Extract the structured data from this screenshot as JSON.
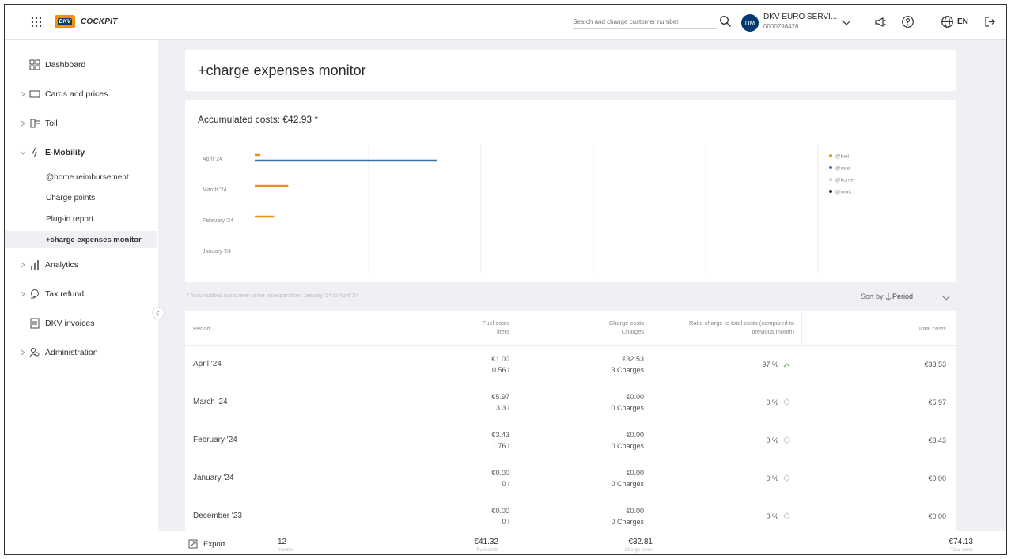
{
  "header": {
    "app_name": "COCKPIT",
    "logo_text": "DKV",
    "search_placeholder": "Search and change customer number",
    "avatar_initials": "DM",
    "customer_name": "DKV EURO SERVI...",
    "customer_number": "0000798428",
    "language": "EN",
    "icons": [
      "apps-grid-icon",
      "search-icon",
      "chevron-down-icon",
      "megaphone-icon",
      "help-icon",
      "globe-icon",
      "logout-icon"
    ]
  },
  "sidebar": {
    "items": [
      {
        "label": "Dashboard",
        "icon": "dashboard-icon"
      },
      {
        "label": "Cards and prices",
        "icon": "card-icon"
      },
      {
        "label": "Toll",
        "icon": "toll-icon"
      },
      {
        "label": "E-Mobility",
        "icon": "lightning-icon"
      },
      {
        "label": "Analytics",
        "icon": "bar-chart-icon"
      },
      {
        "label": "Tax refund",
        "icon": "tax-refund-icon"
      },
      {
        "label": "DKV invoices",
        "icon": "invoice-icon"
      },
      {
        "label": "Administration",
        "icon": "users-icon"
      }
    ],
    "emobility_sub": [
      {
        "label": "@home reimbursement"
      },
      {
        "label": "Charge points"
      },
      {
        "label": "Plug-in report"
      },
      {
        "label": "+charge expenses monitor"
      }
    ]
  },
  "page": {
    "title": "+charge expenses monitor",
    "accumulated": "Accumulated costs: €42.93 *",
    "footnote": "* Accumulated costs refer to the timespan from January '24 to April '24",
    "sort_label": "Sort by:",
    "sort_value": "Period"
  },
  "colors": {
    "fuel": "#e8921e",
    "road": "#3f6fa6",
    "home": "#cccccc",
    "work": "#2b2b2b",
    "brand": "#003a70",
    "accent": "#f39200"
  },
  "chart_data": {
    "type": "bar",
    "orientation": "horizontal",
    "categories": [
      "April '24",
      "March '24",
      "February '24",
      "January '24"
    ],
    "series": [
      {
        "name": "@fuel",
        "values": [
          1.0,
          5.97,
          3.43,
          0.0
        ]
      },
      {
        "name": "@road",
        "values": [
          32.53,
          0,
          0,
          0
        ]
      },
      {
        "name": "@home",
        "values": [
          0,
          0,
          0,
          0
        ]
      },
      {
        "name": "@work",
        "values": [
          0,
          0,
          0,
          0
        ]
      }
    ],
    "xlim": [
      0,
      100
    ],
    "grid": true,
    "legend_position": "right"
  },
  "table": {
    "headers": {
      "period": "Period",
      "fuel": "Fuel costs",
      "fuel_sub": "liters",
      "charge": "Charge costs",
      "charge_sub": "Charges",
      "ratio": "Ratio charge to total costs (compared to",
      "ratio_sub": "previous month)",
      "total": "Total costs"
    },
    "rows": [
      {
        "period": "April '24",
        "fuel": "€1.00",
        "liters": "0.56 l",
        "charge": "€32.53",
        "charges": "3 Charges",
        "ratio": "97 %",
        "trend": "up",
        "total": "€33.53"
      },
      {
        "period": "March '24",
        "fuel": "€5.97",
        "liters": "3.3 l",
        "charge": "€0.00",
        "charges": "0 Charges",
        "ratio": "0 %",
        "trend": "neutral",
        "total": "€5.97"
      },
      {
        "period": "February '24",
        "fuel": "€3.43",
        "liters": "1.76 l",
        "charge": "€0.00",
        "charges": "0 Charges",
        "ratio": "0 %",
        "trend": "neutral",
        "total": "€3.43"
      },
      {
        "period": "January '24",
        "fuel": "€0.00",
        "liters": "0 l",
        "charge": "€0.00",
        "charges": "0 Charges",
        "ratio": "0 %",
        "trend": "neutral",
        "total": "€0.00"
      },
      {
        "period": "December '23",
        "fuel": "€0.00",
        "liters": "0 l",
        "charge": "€0.00",
        "charges": "0 Charges",
        "ratio": "0 %",
        "trend": "neutral",
        "total": "€0.00"
      }
    ]
  },
  "footer": {
    "export_label": "Export",
    "months_value": "12",
    "months_label": "months",
    "fuel_total": "€41.32",
    "fuel_label": "Fuel costs",
    "charge_total": "€32.81",
    "charge_label": "Charge costs",
    "total": "€74.13",
    "total_label": "Total costs"
  }
}
